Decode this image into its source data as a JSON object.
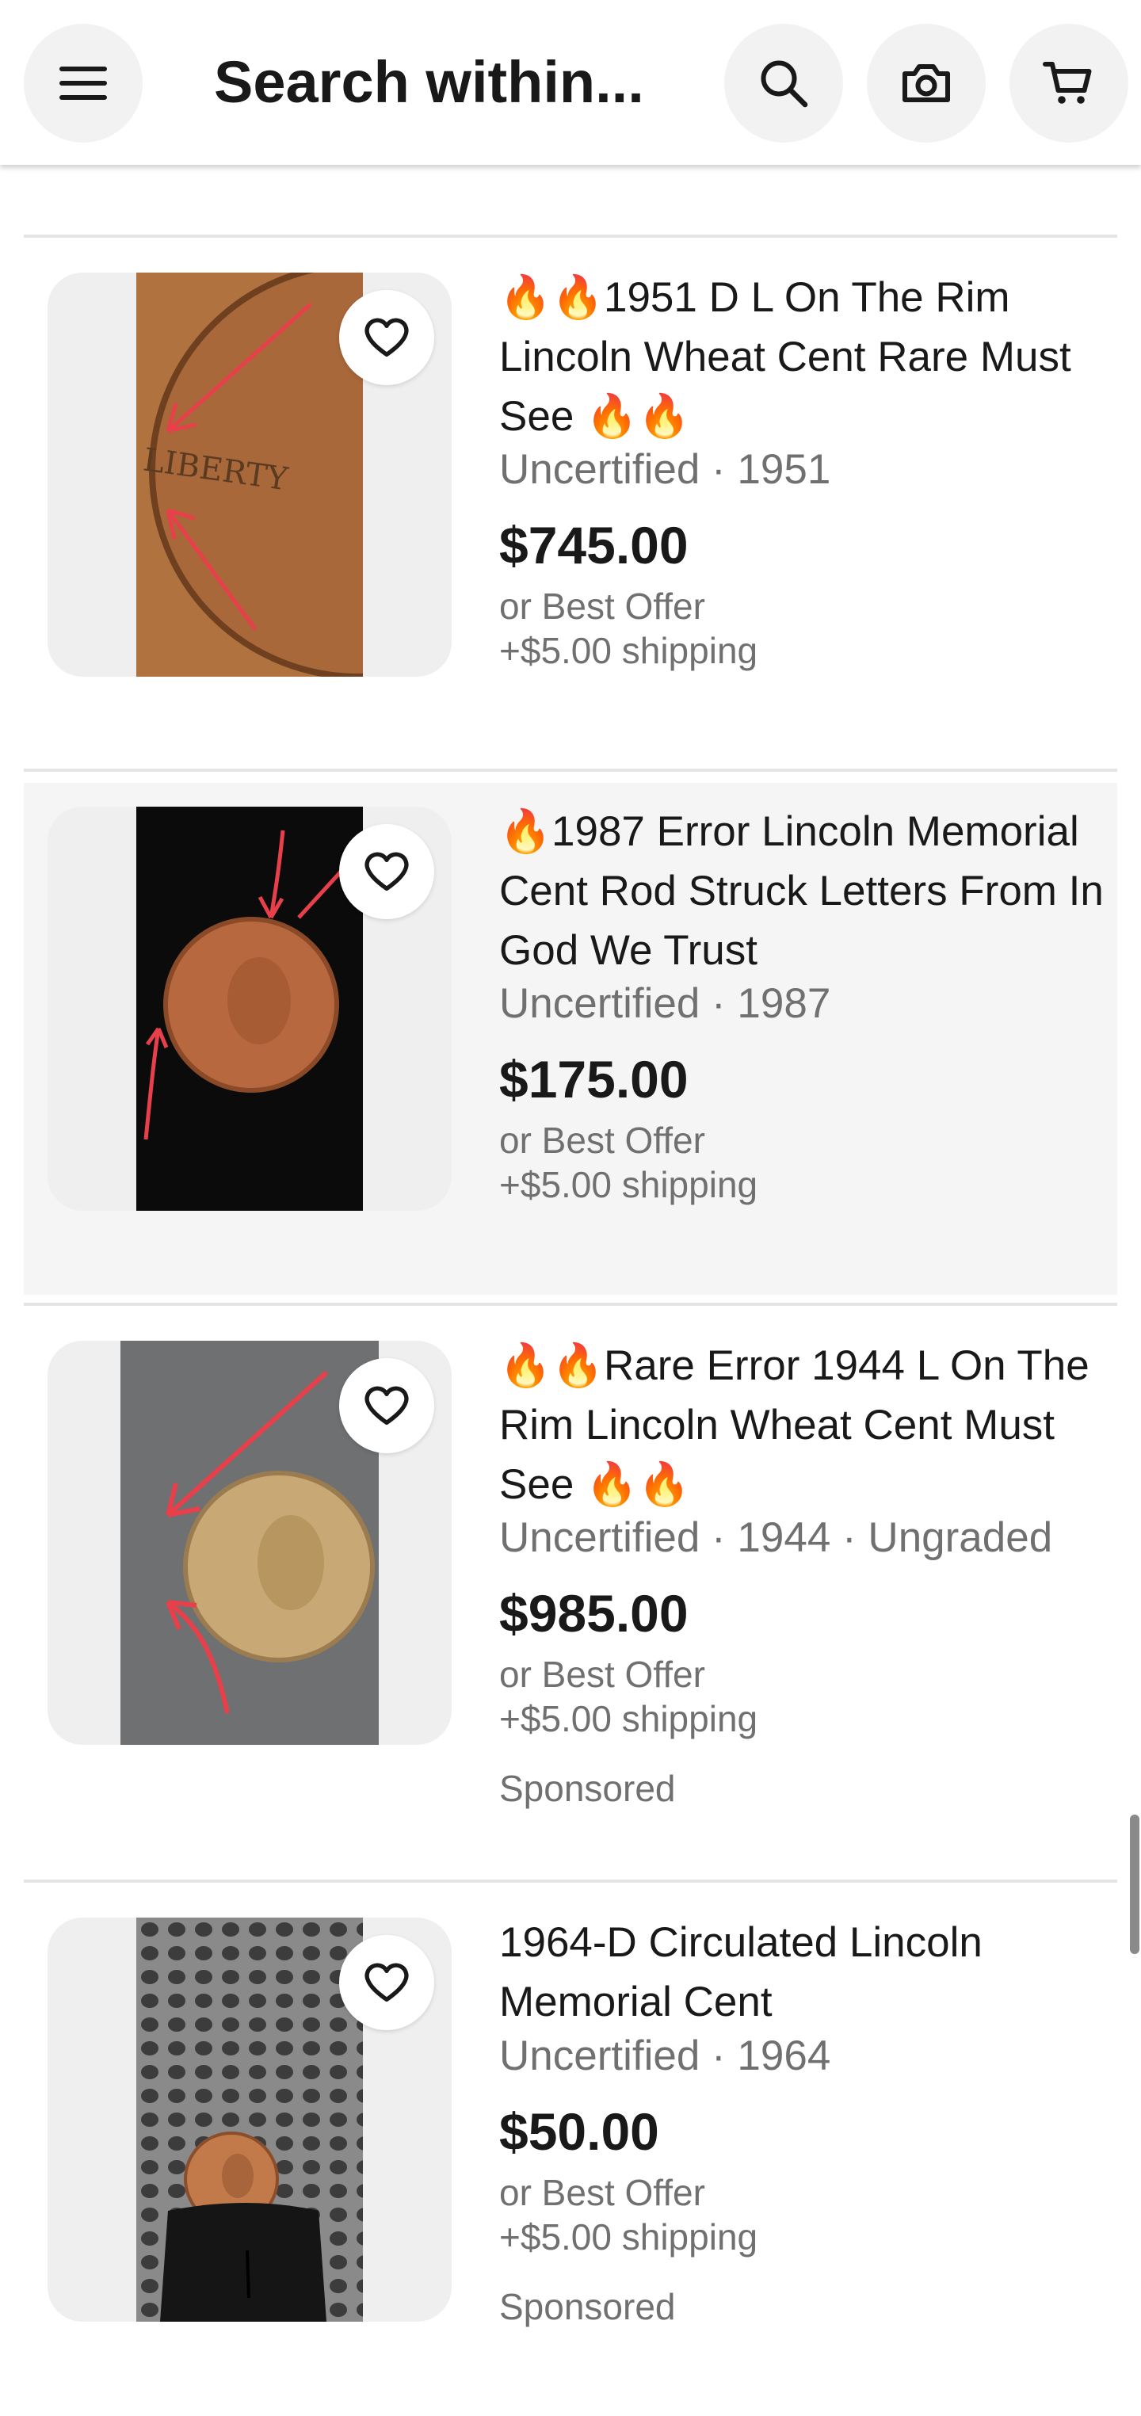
{
  "header": {
    "title": "Search within...",
    "icons": [
      "menu-icon",
      "search-icon",
      "camera-icon",
      "cart-icon"
    ]
  },
  "listings": [
    {
      "title": "🔥🔥1951 D L On The Rim Lincoln Wheat Cent Rare Must See 🔥🔥",
      "subtitle": "Uncertified · 1951",
      "price": "$745.00",
      "offer": "or Best Offer",
      "shipping": "+$5.00 shipping",
      "sponsored": ""
    },
    {
      "title": "🔥1987 Error Lincoln Memorial Cent Rod Struck Letters From In God We Trust",
      "subtitle": "Uncertified · 1987",
      "price": "$175.00",
      "offer": "or Best Offer",
      "shipping": "+$5.00 shipping",
      "sponsored": ""
    },
    {
      "title": "🔥🔥Rare Error 1944 L On The Rim Lincoln Wheat Cent Must See 🔥🔥",
      "subtitle": "Uncertified · 1944 · Ungraded",
      "price": "$985.00",
      "offer": "or Best Offer",
      "shipping": "+$5.00 shipping",
      "sponsored": "Sponsored"
    },
    {
      "title": "1964-D  Circulated Lincoln Memorial Cent",
      "subtitle": "Uncertified · 1964",
      "price": "$50.00",
      "offer": "or Best Offer",
      "shipping": "+$5.00 shipping",
      "sponsored": "Sponsored"
    }
  ],
  "colors": {
    "text_primary": "#191919",
    "text_secondary": "#707070",
    "shaded_row": "#f5f5f5",
    "button_bg": "#f2f2f2"
  }
}
